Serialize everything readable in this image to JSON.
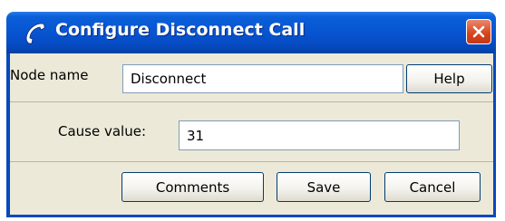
{
  "window": {
    "title": "Configure Disconnect Call",
    "title_icon": "phone-handset-icon",
    "close_icon": "close-icon"
  },
  "form": {
    "node_name_label": "Node name",
    "node_name_value": "Disconnect",
    "help_label": "Help",
    "cause_value_label": "Cause value:",
    "cause_value": "31"
  },
  "buttons": {
    "comments_label": "Comments",
    "save_label": "Save",
    "cancel_label": "Cancel"
  },
  "colors": {
    "titlebar": "#0753d0",
    "client_bg": "#ece9d8",
    "close_button": "#d6431c"
  }
}
